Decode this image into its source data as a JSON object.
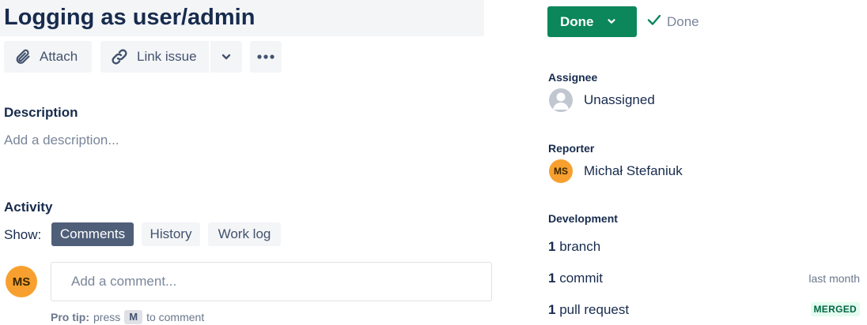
{
  "issue": {
    "title": "Logging as user/admin"
  },
  "toolbar": {
    "attach_label": "Attach",
    "link_issue_label": "Link issue",
    "icons": [
      "paperclip-icon",
      "link-icon",
      "chevron-down-icon",
      "more-icon"
    ]
  },
  "description": {
    "heading": "Description",
    "placeholder": "Add a description..."
  },
  "activity": {
    "heading": "Activity",
    "show_label": "Show:",
    "tabs": [
      {
        "label": "Comments",
        "selected": true
      },
      {
        "label": "History",
        "selected": false
      },
      {
        "label": "Work log",
        "selected": false
      }
    ],
    "comment_avatar_initials": "MS",
    "comment_placeholder": "Add a comment...",
    "protip_bold": "Pro tip:",
    "protip_pre": "press",
    "protip_key": "M",
    "protip_post": "to comment"
  },
  "status": {
    "button_label": "Done",
    "resolution_label": "Done",
    "button_color": "#0b875b"
  },
  "fields": {
    "assignee_label": "Assignee",
    "assignee_value": "Unassigned",
    "reporter_label": "Reporter",
    "reporter_initials": "MS",
    "reporter_value": "Michał Stefaniuk",
    "avatar_color": "#f7a02f"
  },
  "development": {
    "label": "Development",
    "branch_count": "1",
    "branch_label": "branch",
    "commit_count": "1",
    "commit_label": "commit",
    "commit_meta": "last month",
    "pr_count": "1",
    "pr_label": "pull request",
    "pr_status": "MERGED"
  }
}
